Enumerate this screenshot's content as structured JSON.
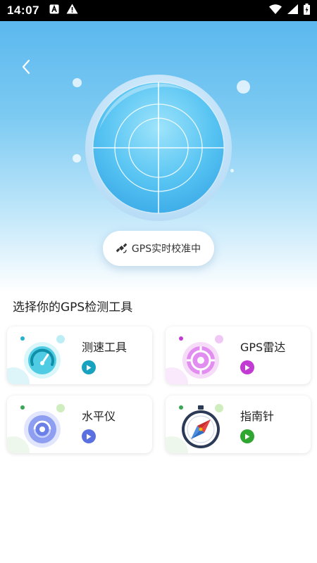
{
  "status_bar": {
    "time": "14:07"
  },
  "header": {
    "back_icon": "chevron-left-icon",
    "status_pill": {
      "icon": "satellite-icon",
      "text": "GPS实时校准中"
    }
  },
  "section": {
    "title": "选择你的GPS检测工具"
  },
  "tools": [
    {
      "label": "测速工具",
      "icon": "speedometer-icon",
      "accent": "#17a3bf",
      "tint": "#bdeef6"
    },
    {
      "label": "GPS雷达",
      "icon": "radar-target-icon",
      "accent": "#c13ad2",
      "tint": "#f1c7f6"
    },
    {
      "label": "水平仪",
      "icon": "level-icon",
      "accent": "#5a6fe0",
      "tint": "#c9d2fb"
    },
    {
      "label": "指南针",
      "icon": "compass-icon",
      "accent": "#2fa62f",
      "tint": "#c9efc0"
    }
  ]
}
